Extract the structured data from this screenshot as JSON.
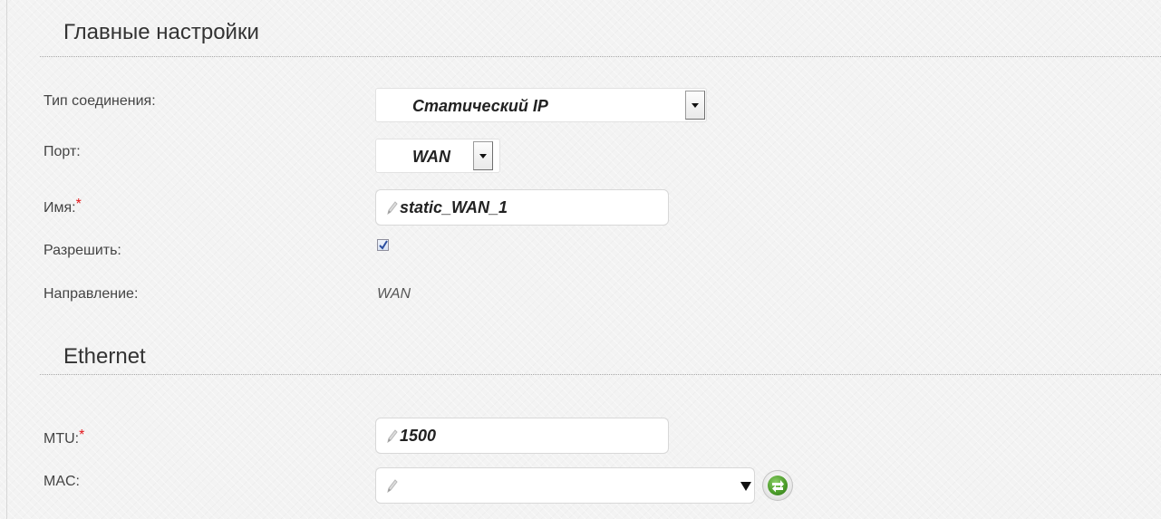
{
  "sections": {
    "main": {
      "title": "Главные настройки"
    },
    "ethernet": {
      "title": "Ethernet"
    }
  },
  "fields": {
    "connection_type": {
      "label": "Тип соединения:",
      "value": "Статический IP"
    },
    "port": {
      "label": "Порт:",
      "value": "WAN"
    },
    "name": {
      "label": "Имя:",
      "required_mark": "*",
      "value": "static_WAN_1"
    },
    "enable": {
      "label": "Разрешить:",
      "checked": true
    },
    "direction": {
      "label": "Направление:",
      "value": "WAN"
    },
    "mtu": {
      "label": "MTU:",
      "required_mark": "*",
      "value": "1500"
    },
    "mac": {
      "label": "MAC:",
      "value": ""
    }
  },
  "icons": {
    "input_edit": "pencil-icon",
    "dropdown": "chevron-down-icon",
    "mac_refresh": "refresh-arrows-icon"
  },
  "colors": {
    "required_mark": "#e3171b",
    "refresh_green": "#4e9e2c"
  }
}
